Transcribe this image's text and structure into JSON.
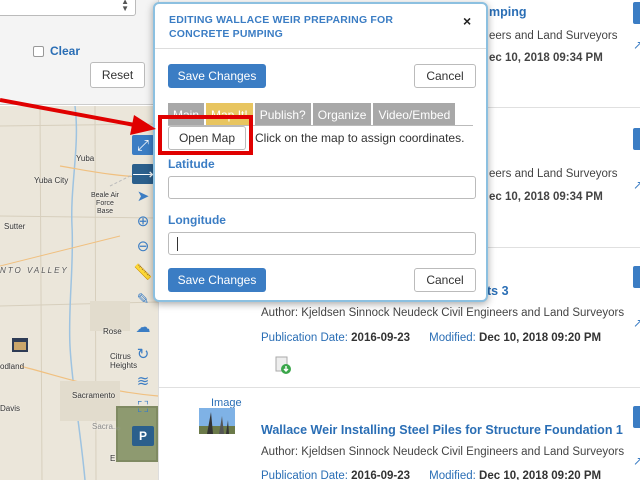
{
  "filters": {
    "clear_label": "Clear",
    "reset_label": "Reset"
  },
  "map": {
    "labels": {
      "yuba": "Yuba",
      "yuba_city": "Yuba City",
      "beale": "Beale Air Force Base",
      "sutter": "Sutter",
      "valley": "NTO VALLEY",
      "rose": "Rose",
      "citrus": "Citrus Heights",
      "woodland": "odland",
      "sacramento": "Sacramento",
      "sacra2": "Sacra...",
      "davis": "Davis",
      "e": "E"
    },
    "tools": [
      "expand-icon",
      "arrow-right-icon",
      "pointer-icon",
      "zoom-in-icon",
      "zoom-out-icon",
      "ruler-icon",
      "pencil-icon",
      "upload-icon",
      "refresh-icon",
      "layers-icon",
      "fullscreen-icon",
      "parking-icon"
    ]
  },
  "dialog": {
    "title": "EDITING WALLACE WEIR PREPARING FOR CONCRETE PUMPING",
    "close": "×",
    "save_top": "Save Changes",
    "cancel_top": "Cancel",
    "tabs": [
      "Main",
      "Map It!",
      "Publish?",
      "Organize",
      "Video/Embed"
    ],
    "active_tab": 1,
    "open_map": "Open Map",
    "assign_hint": "Click on the map to assign coordinates.",
    "latitude_label": "Latitude",
    "latitude_value": "",
    "longitude_label": "Longitude",
    "longitude_value": "",
    "save_bottom": "Save Changes",
    "cancel_bottom": "Cancel"
  },
  "results": [
    {
      "title_fragment": "mping",
      "author_fragment": "eers and Land Surveyors",
      "modified_fragment": "ec 10, 2018 09:34 PM"
    },
    {
      "author_fragment": "eers and Land Surveyors",
      "modified_fragment": "ec 10, 2018 09:34 PM"
    },
    {
      "title_fragment": "ts 3",
      "author": "Author: Kjeldsen Sinnock Neudeck Civil Engineers and Land Surveyors",
      "pub_label": "Publication Date:",
      "pub_value": "2016-09-23",
      "mod_label": "Modified:",
      "mod_value": "Dec 10, 2018 09:20 PM"
    },
    {
      "type": "Image",
      "title": "Wallace Weir Installing Steel Piles for Structure Foundation 1",
      "author": "Author: Kjeldsen Sinnock Neudeck Civil Engineers and Land Surveyors",
      "pub_label": "Publication Date:",
      "pub_value": "2016-09-23",
      "mod_label": "Modified:",
      "mod_value": "Dec 10, 2018 09:20 PM"
    }
  ],
  "colors": {
    "accent": "#3b7dc4",
    "active_tab": "#e8c560",
    "annotation": "#e00000"
  }
}
